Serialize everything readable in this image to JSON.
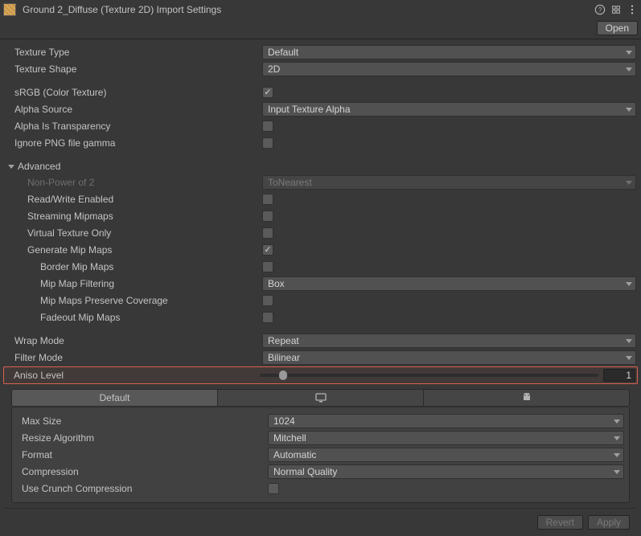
{
  "header": {
    "title": "Ground 2_Diffuse (Texture 2D) Import Settings",
    "open_label": "Open"
  },
  "sections": {
    "textureType": {
      "label": "Texture Type",
      "value": "Default"
    },
    "textureShape": {
      "label": "Texture Shape",
      "value": "2D"
    },
    "srgb": {
      "label": "sRGB (Color Texture)",
      "checked": true
    },
    "alphaSource": {
      "label": "Alpha Source",
      "value": "Input Texture Alpha"
    },
    "alphaIsTransparency": {
      "label": "Alpha Is Transparency",
      "checked": false
    },
    "ignorePngGamma": {
      "label": "Ignore PNG file gamma",
      "checked": false
    },
    "advanced": {
      "label": "Advanced",
      "nonPowerOf2": {
        "label": "Non-Power of 2",
        "value": "ToNearest"
      },
      "readWrite": {
        "label": "Read/Write Enabled",
        "checked": false
      },
      "streamingMipmaps": {
        "label": "Streaming Mipmaps",
        "checked": false
      },
      "virtualTextureOnly": {
        "label": "Virtual Texture Only",
        "checked": false
      },
      "generateMipMaps": {
        "label": "Generate Mip Maps",
        "checked": true
      },
      "borderMipMaps": {
        "label": "Border Mip Maps",
        "checked": false
      },
      "mipMapFiltering": {
        "label": "Mip Map Filtering",
        "value": "Box"
      },
      "preserveCoverage": {
        "label": "Mip Maps Preserve Coverage",
        "checked": false
      },
      "fadeoutMipMaps": {
        "label": "Fadeout Mip Maps",
        "checked": false
      }
    },
    "wrapMode": {
      "label": "Wrap Mode",
      "value": "Repeat"
    },
    "filterMode": {
      "label": "Filter Mode",
      "value": "Bilinear"
    },
    "anisoLevel": {
      "label": "Aniso Level",
      "value": "1"
    }
  },
  "tabs": {
    "default_label": "Default"
  },
  "platform": {
    "maxSize": {
      "label": "Max Size",
      "value": "1024"
    },
    "resizeAlgorithm": {
      "label": "Resize Algorithm",
      "value": "Mitchell"
    },
    "format": {
      "label": "Format",
      "value": "Automatic"
    },
    "compression": {
      "label": "Compression",
      "value": "Normal Quality"
    },
    "crunch": {
      "label": "Use Crunch Compression",
      "checked": false
    }
  },
  "footer": {
    "revert_label": "Revert",
    "apply_label": "Apply"
  }
}
